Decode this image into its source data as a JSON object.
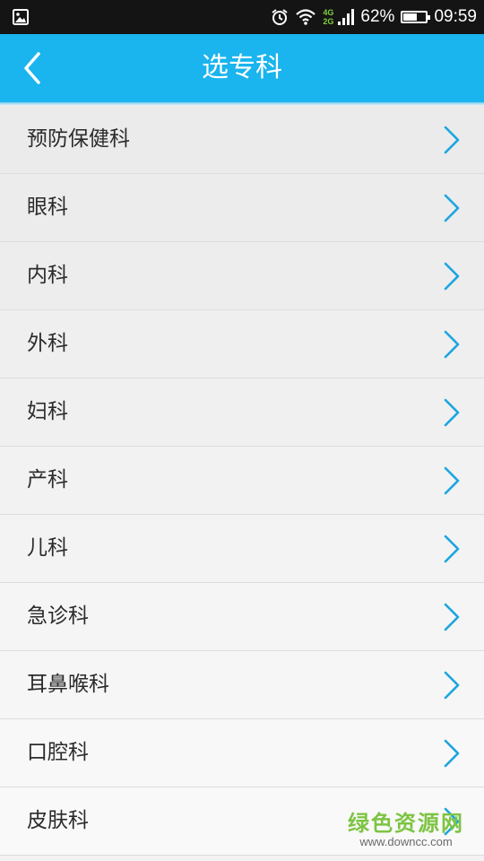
{
  "status_bar": {
    "network_top": "4G",
    "network_bottom": "2G",
    "battery_percent": "62%",
    "battery_level": 0.62,
    "time": "09:59",
    "icons": [
      "gallery-icon",
      "alarm-icon",
      "wifi-icon",
      "signal-icon",
      "battery-icon"
    ]
  },
  "header": {
    "title": "选专科",
    "back_icon": "chevron-left-icon",
    "background_color": "#1ab4ee"
  },
  "departments": [
    {
      "label": "预防保健科"
    },
    {
      "label": "眼科"
    },
    {
      "label": "内科"
    },
    {
      "label": "外科"
    },
    {
      "label": "妇科"
    },
    {
      "label": "产科"
    },
    {
      "label": "儿科"
    },
    {
      "label": "急诊科"
    },
    {
      "label": "耳鼻喉科"
    },
    {
      "label": "口腔科"
    },
    {
      "label": "皮肤科"
    }
  ],
  "accent_color": "#1ba6e0",
  "watermark": {
    "title": "绿色资源网",
    "url": "www.downcc.com"
  }
}
